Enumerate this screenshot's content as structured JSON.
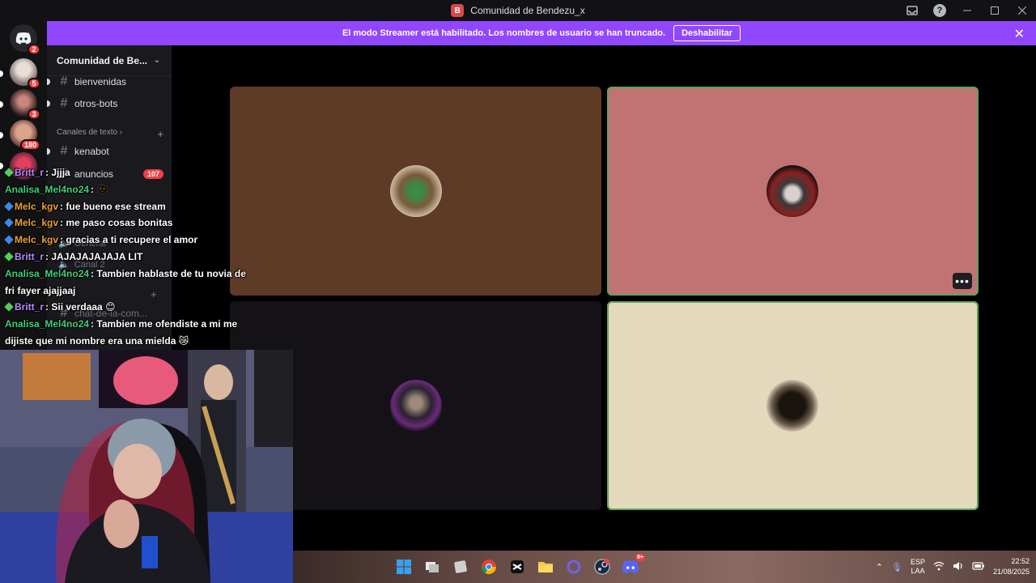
{
  "window": {
    "title": "Comunidad de Bendezu_x"
  },
  "banner": {
    "message": "El modo Streamer está habilitado. Los nombres de usuario se han truncado.",
    "button_label": "Deshabilitar"
  },
  "rail": {
    "discord_badge": "2",
    "guild_badges": [
      "5",
      "3",
      "180"
    ]
  },
  "sidebar": {
    "server_name": "Comunidad de Be...",
    "channels_top": [
      {
        "name": "bienvenidas"
      },
      {
        "name": "otros-bots"
      }
    ],
    "category_text": "Canales de texto",
    "channels_text": [
      {
        "name": "kenabot"
      },
      {
        "name": "anuncios",
        "unread": "107"
      }
    ],
    "voice_channels": [
      "General",
      "Canal 2"
    ],
    "more_channels": [
      "chat-de-la-com..."
    ]
  },
  "chat": {
    "messages": [
      {
        "user": "Britt_r",
        "color": "#b98bff",
        "badge": "green",
        "text": "Jjjja"
      },
      {
        "user": "Analisa_Mel4no24",
        "color": "#3fd17a",
        "badge": "",
        "text": "🫥"
      },
      {
        "user": "Melc_kgv",
        "color": "#f0a030",
        "badge": "blue",
        "text": "fue bueno ese stream"
      },
      {
        "user": "Melc_kgv",
        "color": "#f0a030",
        "badge": "blue",
        "text": "me paso cosas bonitas"
      },
      {
        "user": "Melc_kgv",
        "color": "#f0a030",
        "badge": "blue",
        "text": "gracias a ti recupere el amor"
      },
      {
        "user": "Britt_r",
        "color": "#b98bff",
        "badge": "green",
        "text": "JAJAJAJAJAJA LIT"
      },
      {
        "user": "Analisa_Mel4no24",
        "color": "#3fd17a",
        "badge": "",
        "text": "Tambien hablaste de tu novia de fri fayer ajajjaaj"
      },
      {
        "user": "Britt_r",
        "color": "#b98bff",
        "badge": "green",
        "text": "Sii verdaaa 😊"
      },
      {
        "user": "Analisa_Mel4no24",
        "color": "#3fd17a",
        "badge": "",
        "text": "Tambien me ofendiste a mi me dijiste que mi nombre era una mielda 😿"
      }
    ]
  },
  "video": {
    "tiles": [
      {
        "bg": "#5e3b27",
        "speaking": false
      },
      {
        "bg": "#c07372",
        "speaking": true
      },
      {
        "bg": "#141216",
        "speaking": false
      },
      {
        "bg": "#e3d9bc",
        "speaking": true
      }
    ],
    "more_label": "•••"
  },
  "taskbar": {
    "lang_top": "ESP",
    "lang_bottom": "LAA",
    "time": "22:52",
    "date": "21/08/2025",
    "discord_badge": "9+"
  },
  "colors": {
    "banner": "#9147ff",
    "speaking_outline": "#5fa55a",
    "mention_badge": "#f23f43"
  }
}
